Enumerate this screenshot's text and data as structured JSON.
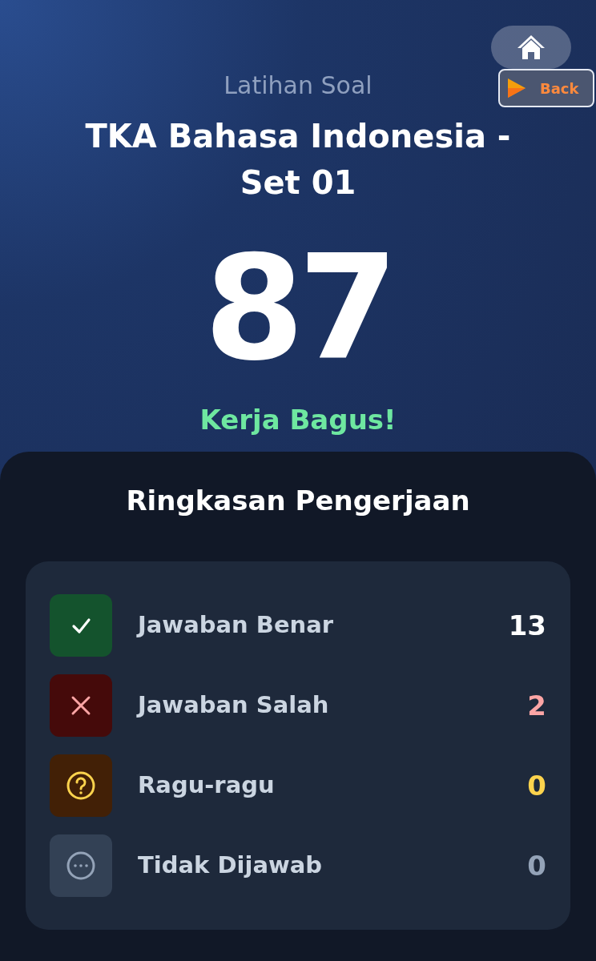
{
  "header": {
    "subtitle": "Latihan Soal",
    "title": "TKA Bahasa Indonesia - Set 01",
    "score": "87",
    "message": "Kerja Bagus!"
  },
  "nav": {
    "back_label": "Back"
  },
  "summary": {
    "title": "Ringkasan Pengerjaan",
    "items": [
      {
        "kind": "correct",
        "label": "Jawaban Benar",
        "count": "13"
      },
      {
        "kind": "wrong",
        "label": "Jawaban Salah",
        "count": "2"
      },
      {
        "kind": "doubt",
        "label": "Ragu-ragu",
        "count": "0"
      },
      {
        "kind": "unanswered",
        "label": "Tidak Dijawab",
        "count": "0"
      }
    ]
  }
}
